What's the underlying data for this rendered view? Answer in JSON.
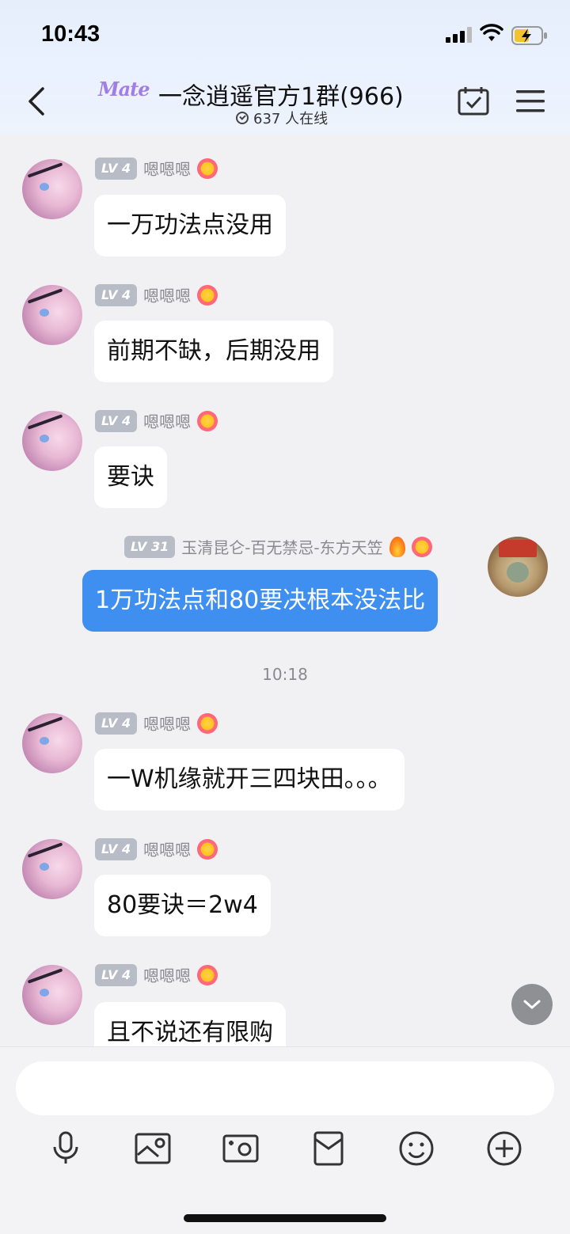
{
  "status_bar": {
    "time": "10:43"
  },
  "header": {
    "brand_logo": "Mate",
    "title": "一念逍遥官方1群(966)",
    "online_text": "637 人在线",
    "icons": [
      "back-chevron-icon",
      "calendar-check-icon",
      "menu-icon"
    ]
  },
  "messages": [
    {
      "sender": "嗯嗯嗯",
      "level": "LV 4",
      "text": "一万功法点没用",
      "self": false
    },
    {
      "sender": "嗯嗯嗯",
      "level": "LV 4",
      "text": "前期不缺，后期没用",
      "self": false
    },
    {
      "sender": "嗯嗯嗯",
      "level": "LV 4",
      "text": "要诀",
      "self": false
    },
    {
      "sender": "玉清昆仑-百无禁忌-东方天笠",
      "level": "LV 31",
      "text": "1万功法点和80要决根本没法比",
      "self": true
    },
    {
      "sender": "嗯嗯嗯",
      "level": "LV 4",
      "text": "一W机缘就开三四块田。。。",
      "self": false
    },
    {
      "sender": "嗯嗯嗯",
      "level": "LV 4",
      "text": "80要诀＝2w4",
      "self": false
    },
    {
      "sender": "嗯嗯嗯",
      "level": "LV 4",
      "text": "且不说还有限购",
      "self": false
    }
  ],
  "timestamp_divider": "10:18",
  "input": {
    "placeholder": ""
  },
  "toolbar": [
    "microphone-icon",
    "image-icon",
    "camera-icon",
    "red-packet-icon",
    "emoji-icon",
    "plus-icon"
  ],
  "colors": {
    "self_bubble": "#3e8ff0",
    "other_bubble": "#ffffff",
    "background": "#f1f1f3"
  }
}
